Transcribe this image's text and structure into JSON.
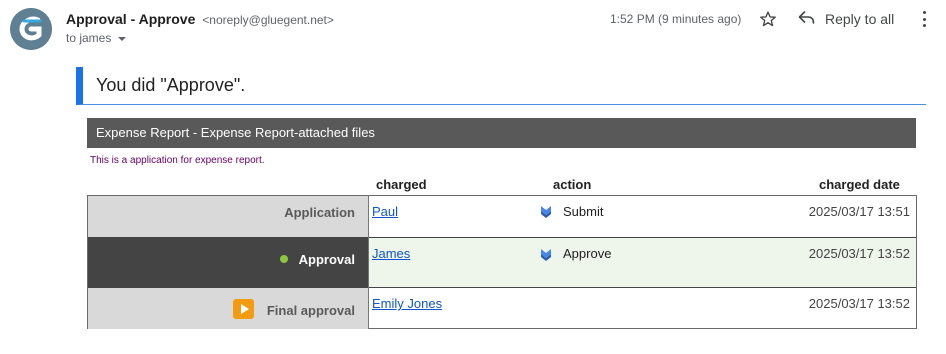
{
  "header": {
    "sender_name": "Approval - Approve",
    "sender_email": "<noreply@gluegent.net>",
    "to_label": "to james",
    "timestamp": "1:52 PM (9 minutes ago)",
    "reply_all_label": "Reply to all"
  },
  "icons": {
    "avatar": "gluegent-logo-icon",
    "star": "star-icon",
    "reply_all": "reply-all-icon",
    "more": "more-vertical-icon",
    "action": "down-arrow-icon",
    "current_step": "current-step-dot-icon",
    "final_step": "play-icon"
  },
  "colors": {
    "banner_accent": "#1a73e8",
    "report_header_bg": "#595959",
    "current_row_bg": "#444444",
    "current_dot": "#8dc63f",
    "link": "#1155cc",
    "play_icon": "#f39c12"
  },
  "message": {
    "result_text": "You did \"Approve\".",
    "report_title": "Expense Report - Expense Report-attached files",
    "report_description": "This is a application for expense report."
  },
  "table": {
    "columns": {
      "charged": "charged",
      "action": "action",
      "charged_date": "charged date"
    },
    "rows": [
      {
        "step": "Application",
        "charged": "Paul",
        "action": "Submit",
        "date": "2025/03/17 13:51"
      },
      {
        "step": "Approval",
        "charged": "James",
        "action": "Approve",
        "date": "2025/03/17 13:52"
      },
      {
        "step": "Final approval",
        "charged": "Emily Jones",
        "action": "",
        "date": "2025/03/17 13:52"
      }
    ]
  }
}
